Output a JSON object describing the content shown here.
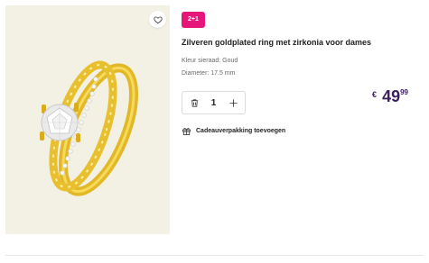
{
  "product": {
    "promo_badge": "2+1",
    "title": "Zilveren goldplated ring met zirkonia voor dames",
    "color_spec": "Kleur sieraad: Goud",
    "diameter_spec": "Diameter: 17.5 mm",
    "image_description": "gold ring set with solitaire stone"
  },
  "quantity": {
    "value": "1"
  },
  "price": {
    "currency": "€",
    "whole": "49",
    "cents": "99"
  },
  "gift": {
    "label": "Cadeauverpakking toevoegen"
  },
  "icons": {
    "wishlist": "heart-icon",
    "remove": "trash-icon",
    "increment": "plus-icon",
    "gift": "gift-icon"
  },
  "colors": {
    "badge": "#e5157a",
    "price": "#3b1f5c",
    "image_bg": "#f3f0e4",
    "gold": "#e5bd2c"
  }
}
